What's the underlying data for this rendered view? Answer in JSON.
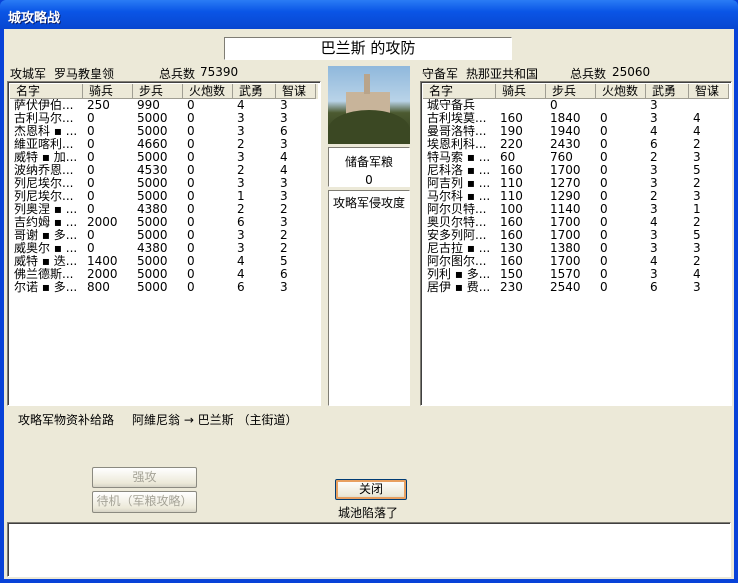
{
  "window": {
    "title": "城攻略战"
  },
  "battle_title": "巴兰斯 的攻防",
  "attacker": {
    "label": "攻城军",
    "faction": "罗马教皇领",
    "total_label": "总兵数",
    "total": "75390"
  },
  "defender": {
    "label": "守备军",
    "faction": "热那亚共和国",
    "total_label": "总兵数",
    "total": "25060"
  },
  "columns": [
    "名字",
    "骑兵",
    "步兵",
    "火炮数",
    "武勇",
    "智谋"
  ],
  "attacker_rows": [
    [
      "萨伏伊伯...",
      "250",
      "990",
      "0",
      "4",
      "3"
    ],
    [
      "古利马尔...",
      "0",
      "5000",
      "0",
      "3",
      "3"
    ],
    [
      "杰恩科 ▪ ...",
      "0",
      "5000",
      "0",
      "3",
      "6"
    ],
    [
      "維亚喀利...",
      "0",
      "4660",
      "0",
      "2",
      "3"
    ],
    [
      "威特 ▪ 加...",
      "0",
      "5000",
      "0",
      "3",
      "4"
    ],
    [
      "波纳乔恩...",
      "0",
      "4530",
      "0",
      "2",
      "4"
    ],
    [
      "列尼埃尔...",
      "0",
      "5000",
      "0",
      "3",
      "3"
    ],
    [
      "列尼埃尔...",
      "0",
      "5000",
      "0",
      "1",
      "3"
    ],
    [
      "列奥涅 ▪ ...",
      "0",
      "4380",
      "0",
      "2",
      "2"
    ],
    [
      "吉约姆 ▪ ...",
      "2000",
      "5000",
      "0",
      "6",
      "3"
    ],
    [
      "哥谢 ▪ 多...",
      "0",
      "5000",
      "0",
      "3",
      "2"
    ],
    [
      "威奥尔 ▪ ...",
      "0",
      "4380",
      "0",
      "3",
      "2"
    ],
    [
      "威特 ▪ 迭...",
      "1400",
      "5000",
      "0",
      "4",
      "5"
    ],
    [
      "佛兰德斯...",
      "2000",
      "5000",
      "0",
      "4",
      "6"
    ],
    [
      "尔诺 ▪ 多...",
      "800",
      "5000",
      "0",
      "6",
      "3"
    ]
  ],
  "defender_rows": [
    [
      "城守备兵",
      "",
      "0",
      "",
      "3",
      ""
    ],
    [
      "古利埃莫...",
      "160",
      "1840",
      "0",
      "3",
      "4"
    ],
    [
      "曼哥洛特...",
      "190",
      "1940",
      "0",
      "4",
      "4"
    ],
    [
      "埃恩利科...",
      "220",
      "2430",
      "0",
      "6",
      "2"
    ],
    [
      "特马索 ▪ ...",
      "60",
      "760",
      "0",
      "2",
      "3"
    ],
    [
      "尼科洛 ▪ ...",
      "160",
      "1700",
      "0",
      "3",
      "5"
    ],
    [
      "阿吉列 ▪ ...",
      "110",
      "1270",
      "0",
      "3",
      "2"
    ],
    [
      "马尔科 ▪ ...",
      "110",
      "1290",
      "0",
      "2",
      "3"
    ],
    [
      "阿尔贝特...",
      "100",
      "1140",
      "0",
      "3",
      "1"
    ],
    [
      "奥贝尔特...",
      "160",
      "1700",
      "0",
      "4",
      "2"
    ],
    [
      "安多列阿...",
      "160",
      "1700",
      "0",
      "3",
      "5"
    ],
    [
      "尼古拉 ▪ ...",
      "130",
      "1380",
      "0",
      "3",
      "3"
    ],
    [
      "阿尔图尔...",
      "160",
      "1700",
      "0",
      "4",
      "2"
    ],
    [
      "列利 ▪ 多...",
      "150",
      "1570",
      "0",
      "3",
      "4"
    ],
    [
      "居伊 ▪ 费...",
      "230",
      "2540",
      "0",
      "6",
      "3"
    ]
  ],
  "reserve": {
    "label": "储备军粮",
    "value": "0"
  },
  "invasion": {
    "label": "攻略军侵攻度"
  },
  "supply": {
    "label": "攻略军物资补给路",
    "route": "阿維尼翁 → 巴兰斯 （主街道）"
  },
  "buttons": {
    "assault": "强攻",
    "standby": "待机（军粮攻略）",
    "close": "关闭"
  },
  "status": "城池陷落了",
  "log": ""
}
